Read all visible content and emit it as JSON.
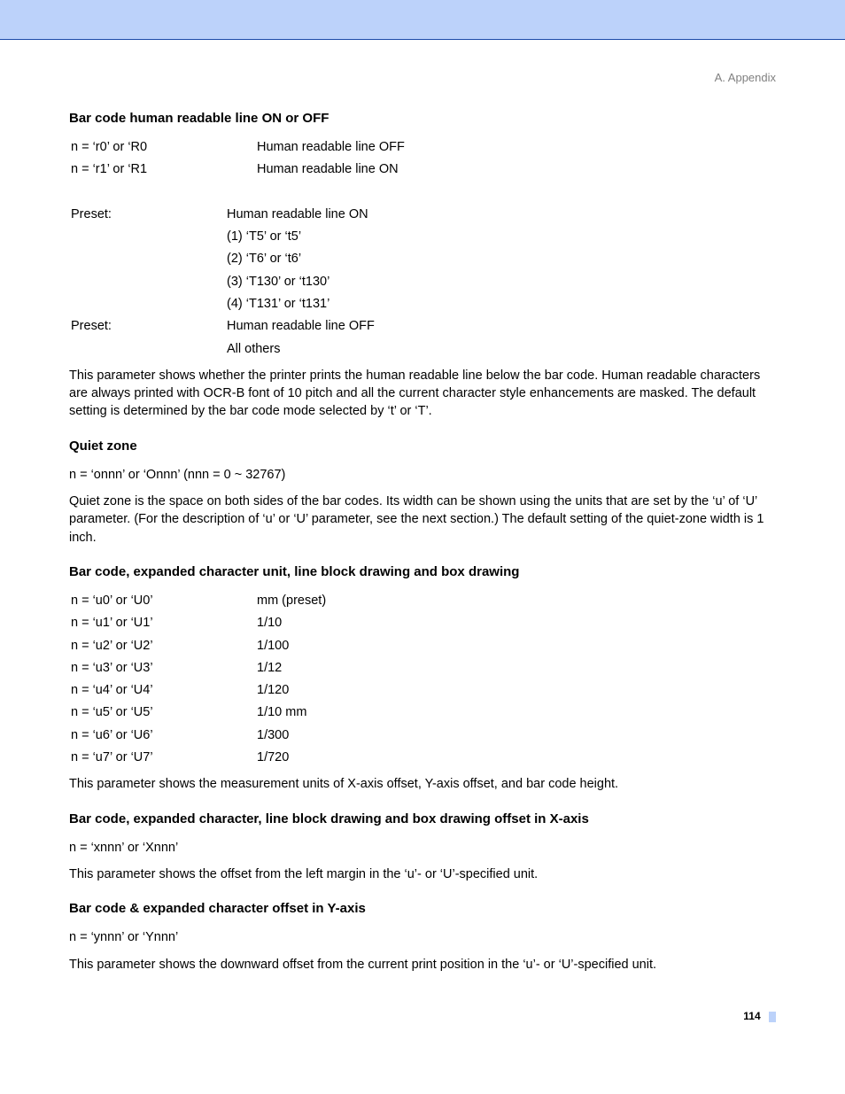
{
  "breadcrumb": "A. Appendix",
  "sections": {
    "hrl": {
      "heading": "Bar code human readable line ON or OFF",
      "rows": [
        {
          "key": "n = ‘r0’ or ‘R0",
          "val": "Human readable line OFF"
        },
        {
          "key": "n = ‘r1’ or ‘R1",
          "val": "Human readable line ON"
        }
      ],
      "preset1_label": "Preset:",
      "preset1_value": "Human readable line ON",
      "preset1_subs": [
        "(1) ‘T5’ or ‘t5’",
        "(2) ‘T6’ or ‘t6’",
        "(3) ‘T130’ or ‘t130’",
        "(4) ‘T131’ or ‘t131’"
      ],
      "preset2_label": "Preset:",
      "preset2_value": "Human readable line OFF",
      "preset2_sub": "All others",
      "para": "This parameter shows whether the printer prints the human readable line below the bar code. Human readable characters are always printed with OCR-B font of 10 pitch and all the current character style enhancements are masked. The default setting is determined by the bar code mode selected by ‘t’ or ‘T’."
    },
    "quiet": {
      "heading": "Quiet zone",
      "line": "n = ‘onnn’ or ‘Onnn’ (nnn = 0 ~ 32767)",
      "para": "Quiet zone is the space on both sides of the bar codes. Its width can be shown using the units that are set by the ‘u’ of ‘U’ parameter. (For the description of ‘u’ or ‘U’ parameter, see the next section.) The default setting of the quiet-zone width is 1 inch."
    },
    "unit": {
      "heading": "Bar code, expanded character unit, line block drawing and box drawing",
      "rows": [
        {
          "key": "n = ‘u0’ or ‘U0’",
          "val": "mm (preset)"
        },
        {
          "key": "n = ‘u1’ or ‘U1’",
          "val": "1/10"
        },
        {
          "key": "n = ‘u2’ or ‘U2’",
          "val": "1/100"
        },
        {
          "key": "n = ‘u3’ or ‘U3’",
          "val": "1/12"
        },
        {
          "key": "n = ‘u4’ or ‘U4’",
          "val": "1/120"
        },
        {
          "key": "n = ‘u5’ or ‘U5’",
          "val": "1/10 mm"
        },
        {
          "key": "n = ‘u6’ or ‘U6’",
          "val": "1/300"
        },
        {
          "key": "n = ‘u7’ or ‘U7’",
          "val": "1/720"
        }
      ],
      "para": "This parameter shows the measurement units of X-axis offset, Y-axis offset, and bar code height."
    },
    "xoff": {
      "heading": "Bar code, expanded character, line block drawing and box drawing offset in X-axis",
      "line": "n = ‘xnnn’ or ‘Xnnn’",
      "para": "This parameter shows the offset from the left margin in the ‘u’- or ‘U’-specified unit."
    },
    "yoff": {
      "heading": "Bar code & expanded character offset in Y-axis",
      "line": "n = ‘ynnn’ or ‘Ynnn’",
      "para": "This parameter shows the downward offset from the current print position in the ‘u’- or ‘U’-specified unit."
    }
  },
  "page_number": "114"
}
